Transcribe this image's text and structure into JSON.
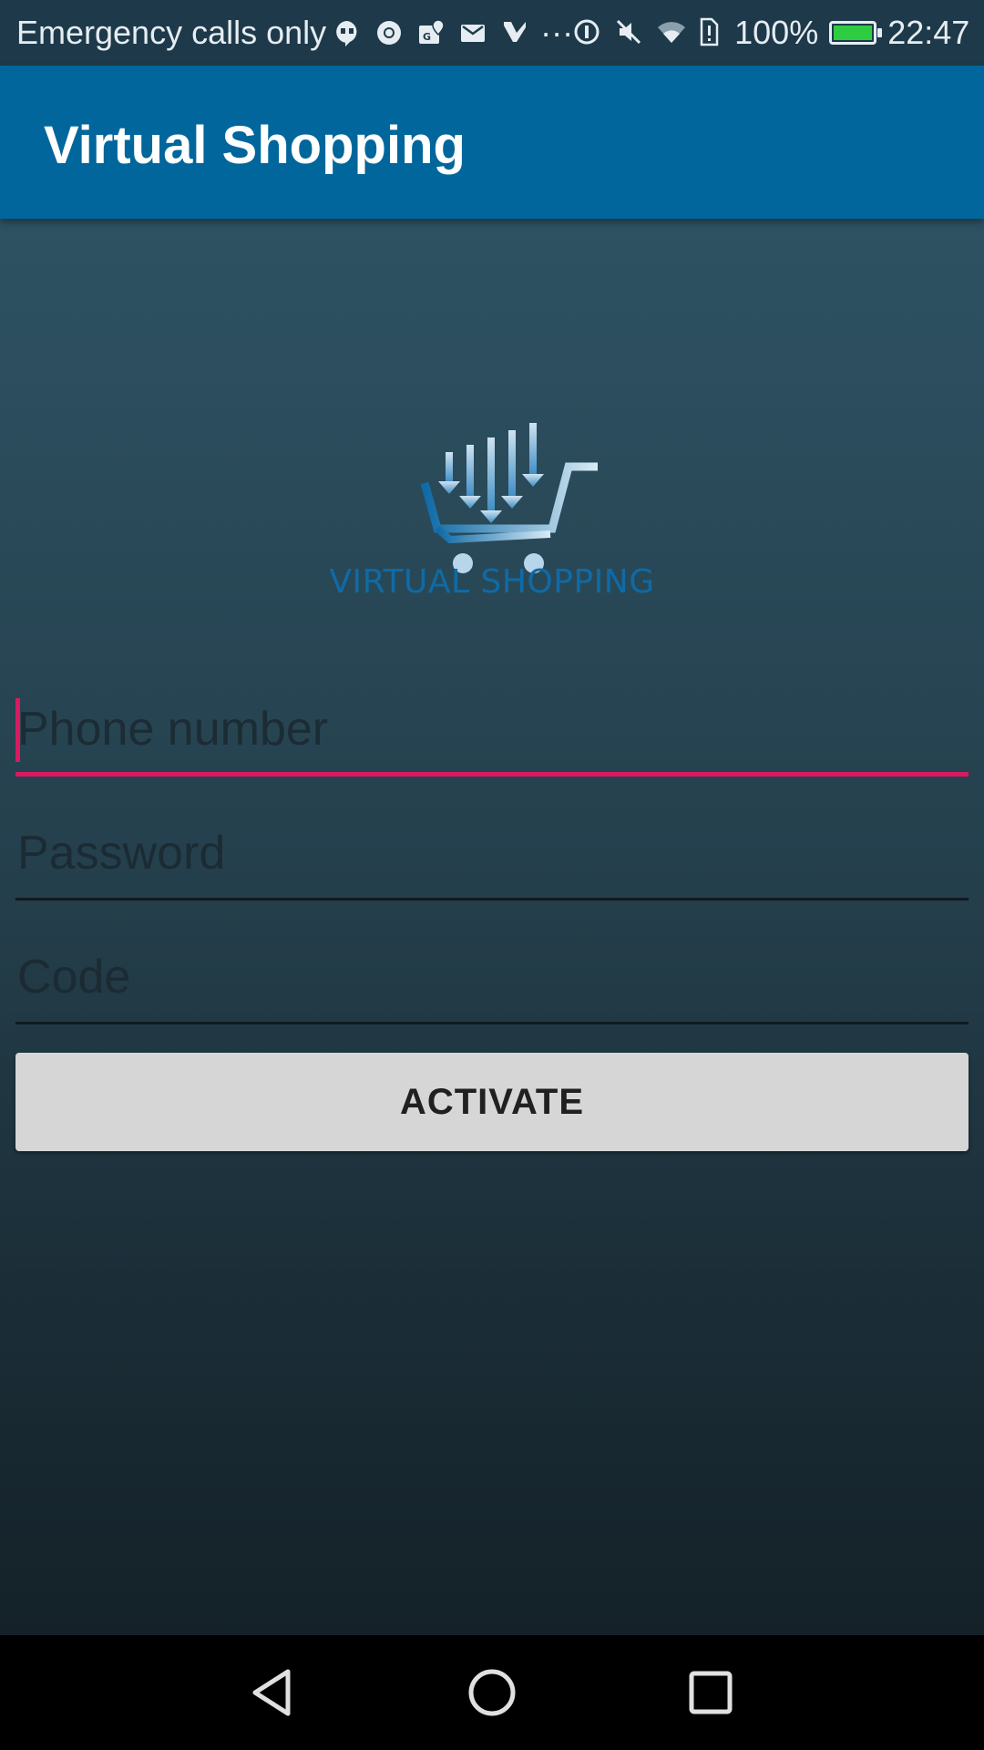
{
  "status_bar": {
    "carrier": "Emergency calls only",
    "battery_percent": "100%",
    "battery_level": 1.0,
    "time": "22:47",
    "icons": [
      "hangouts-icon",
      "chrome-icon",
      "maps-icon",
      "gmail-icon",
      "check-icon",
      "more-icon",
      "data-saver-icon",
      "mute-icon",
      "wifi-icon",
      "sim-alert-icon",
      "battery-icon"
    ],
    "more_glyph": "···"
  },
  "app_bar": {
    "title": "Virtual Shopping",
    "color": "#00669c"
  },
  "logo": {
    "text": "VIRTUAL SHOPPING",
    "color": "#0f6aa6"
  },
  "form": {
    "phone": {
      "value": "",
      "placeholder": "Phone number"
    },
    "password": {
      "value": "",
      "placeholder": "Password"
    },
    "code": {
      "value": "",
      "placeholder": "Code"
    },
    "accent_color": "#d81b60"
  },
  "activate_button": {
    "label": "ACTIVATE"
  },
  "nav_bar": {
    "icons": [
      "back-icon",
      "home-icon",
      "recents-icon"
    ]
  }
}
